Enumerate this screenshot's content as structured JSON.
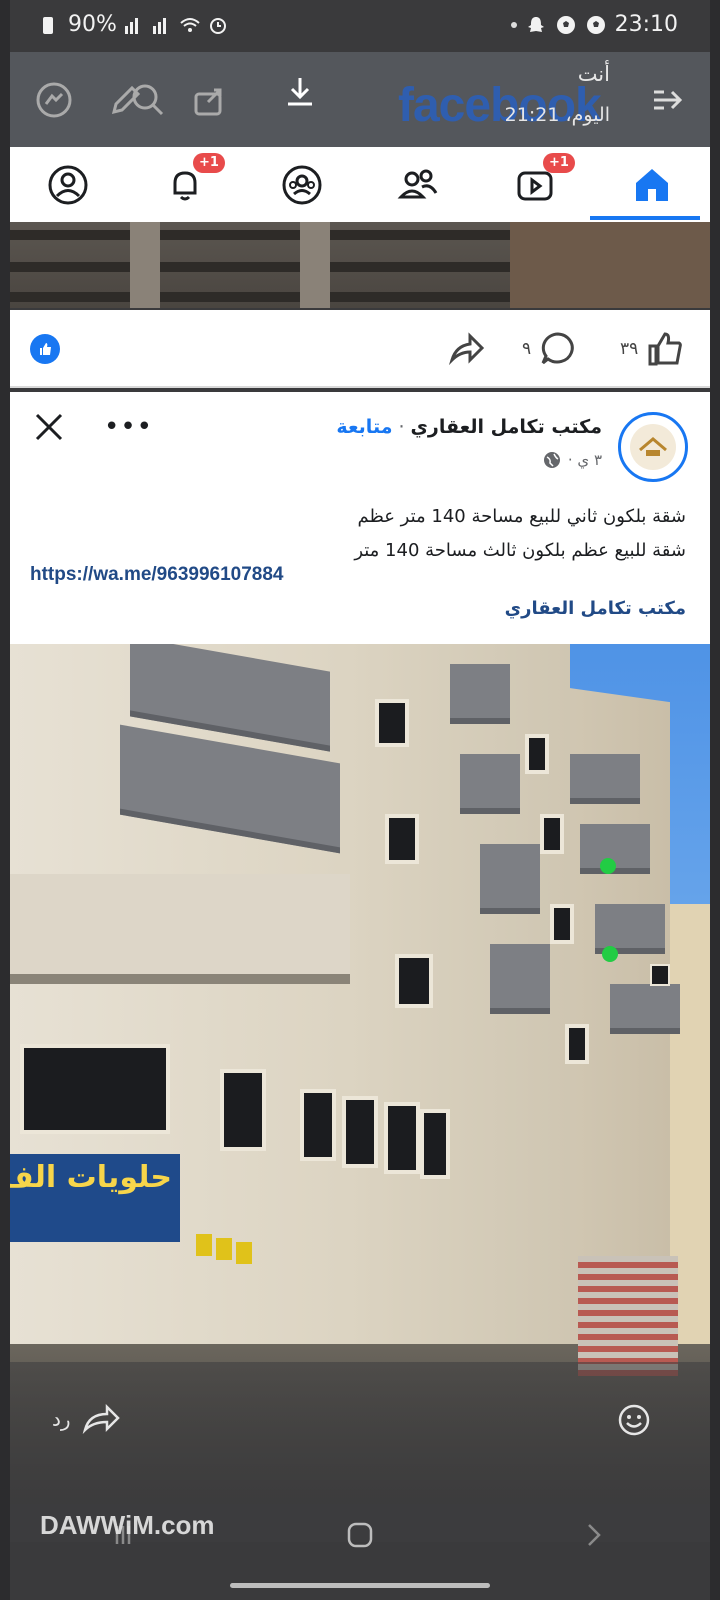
{
  "status_bar": {
    "battery": "90%",
    "time": "23:10"
  },
  "chat_header": {
    "sender": "أنت",
    "timestamp": "اليوم، 21:21",
    "logo_text": "facebook",
    "icons": [
      "messenger-icon",
      "edit-icon",
      "search-icon",
      "share-icon",
      "download-icon",
      "forward-icon"
    ]
  },
  "fb_nav": {
    "items": [
      {
        "name": "profile",
        "icon": "profile-icon"
      },
      {
        "name": "notifications",
        "icon": "bell-icon",
        "badge": "+1"
      },
      {
        "name": "groups",
        "icon": "groups-icon"
      },
      {
        "name": "friends",
        "icon": "friends-icon"
      },
      {
        "name": "video",
        "icon": "video-icon",
        "badge": "+1"
      },
      {
        "name": "home",
        "icon": "home-icon",
        "active": true
      }
    ],
    "accent": "#1877f2"
  },
  "reactions": {
    "likes": "٣٩",
    "comments": "٩"
  },
  "post": {
    "page_name": "مكتب تكامل العقاري",
    "follow_sep": "·",
    "follow": "متابعة",
    "time": "٣ ي ·",
    "text_line_1": "شقة بلكون ثاني للبيع مساحة 140 متر عظم",
    "text_line_2": "شقة للبيع عظم بلكون ثالث مساحة 140 متر",
    "link": "https://wa.me/963996107884",
    "signature": "مكتب تكامل العقاري"
  },
  "photo": {
    "shop_sign": "حلويات الف"
  },
  "composer": {
    "reply_label": "رد"
  },
  "watermark": "DAWWiM.com"
}
